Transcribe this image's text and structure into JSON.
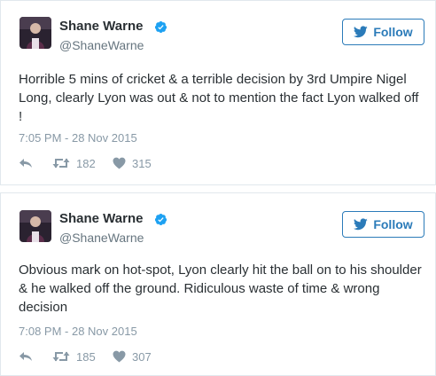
{
  "tweets": [
    {
      "author_name": "Shane Warne",
      "author_handle": "@ShaneWarne",
      "follow_label": "Follow",
      "text": "Horrible 5 mins of cricket & a terrible decision by 3rd Umpire Nigel Long, clearly Lyon was out  & not to mention the fact Lyon walked off !",
      "timestamp": "7:05 PM - 28 Nov 2015",
      "retweets": "182",
      "likes": "315"
    },
    {
      "author_name": "Shane Warne",
      "author_handle": "@ShaneWarne",
      "follow_label": "Follow",
      "text": "Obvious mark on hot-spot, Lyon clearly hit the ball on to his shoulder & he walked off the ground. Ridiculous waste of time & wrong decision",
      "timestamp": "7:08 PM - 28 Nov 2015",
      "retweets": "185",
      "likes": "307"
    }
  ],
  "colors": {
    "accent": "#2b7bb9",
    "verified": "#1da1f2",
    "meta_text": "#8899a6",
    "handle_text": "#66757f"
  },
  "icons": [
    "verified-badge-icon",
    "twitter-bird-icon",
    "reply-icon",
    "retweet-icon",
    "heart-icon"
  ]
}
